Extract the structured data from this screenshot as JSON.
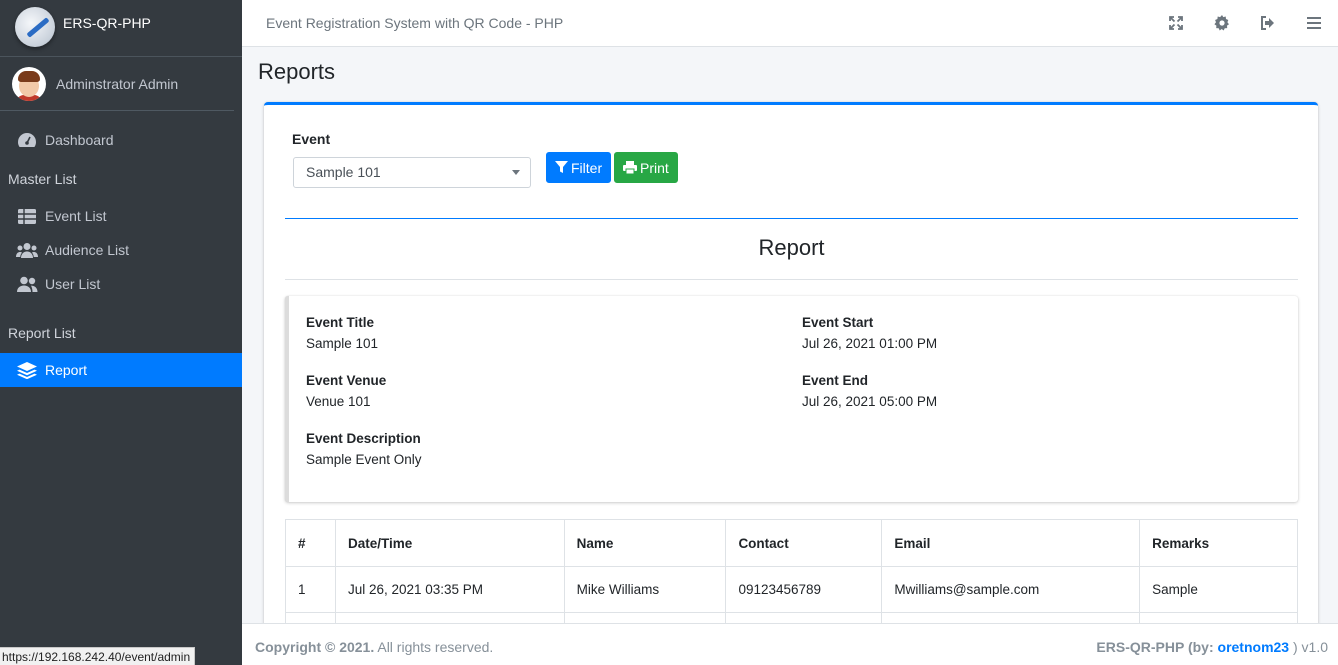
{
  "brand": {
    "name": "ERS-QR-PHP"
  },
  "user": {
    "name": "Adminstrator Admin"
  },
  "sidebar": {
    "dashboard": "Dashboard",
    "master_header": "Master List",
    "event_list": "Event List",
    "audience_list": "Audience List",
    "user_list": "User List",
    "report_header": "Report List",
    "report": "Report"
  },
  "topbar": {
    "title": "Event Registration System with QR Code - PHP"
  },
  "page": {
    "title": "Reports"
  },
  "filter": {
    "label": "Event",
    "selected": "Sample 101",
    "filter_label": "Filter",
    "print_label": "Print"
  },
  "report": {
    "heading": "Report",
    "event_title_label": "Event Title",
    "event_title": "Sample 101",
    "event_start_label": "Event Start",
    "event_start": "Jul 26, 2021 01:00 PM",
    "event_venue_label": "Event Venue",
    "event_venue": "Venue 101",
    "event_end_label": "Event End",
    "event_end": "Jul 26, 2021 05:00 PM",
    "event_desc_label": "Event Description",
    "event_desc": "Sample Event Only"
  },
  "table": {
    "headers": [
      "#",
      "Date/Time",
      "Name",
      "Contact",
      "Email",
      "Remarks"
    ],
    "rows": [
      [
        "1",
        "Jul 26, 2021 03:35 PM",
        "Mike Williams",
        "09123456789",
        "Mwilliams@sample.com",
        "Sample"
      ]
    ]
  },
  "footer": {
    "copyright": "Copyright © 2021.",
    "rights": " All rights reserved.",
    "right_prefix": "ERS-QR-PHP (by: ",
    "author": "oretnom23",
    "right_suffix": " ) v1.0"
  },
  "status_url": "https://192.168.242.40/event/admin",
  "colors": {
    "primary": "#007bff",
    "success": "#28a745",
    "sidebar": "#343a40"
  }
}
